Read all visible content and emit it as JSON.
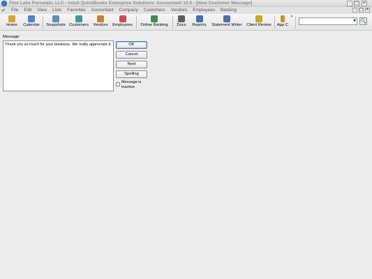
{
  "window": {
    "title": "Pine Lake Porcelain, LLC  -  Intuit QuickBooks Enterprise Solutions: Accountant 12.0 - [New Customer Message]",
    "controls": [
      "–",
      "□",
      "✕"
    ]
  },
  "menu": {
    "items": [
      "File",
      "Edit",
      "View",
      "Lists",
      "Favorites",
      "Accountant",
      "Company",
      "Customers",
      "Vendors",
      "Employees",
      "Banking"
    ],
    "sys_controls": [
      "–",
      "□",
      "✕"
    ]
  },
  "toolbar": {
    "buttons": [
      {
        "label": "Home",
        "icon": "home-icon",
        "color": "#d9a13b"
      },
      {
        "label": "Calendar",
        "icon": "calendar-icon",
        "color": "#4a86c7"
      },
      {
        "label": "Snapshots",
        "icon": "snapshots-icon",
        "color": "#5e8fbf"
      },
      {
        "label": "Customers",
        "icon": "customers-icon",
        "color": "#3f9a8f"
      },
      {
        "label": "Vendors",
        "icon": "vendors-icon",
        "color": "#c9822f"
      },
      {
        "label": "Employees",
        "icon": "employees-icon",
        "color": "#c94f4f"
      },
      {
        "label": "Online Banking",
        "icon": "online-banking-icon",
        "color": "#3f8f4f"
      },
      {
        "label": "Docs",
        "icon": "docs-icon",
        "color": "#5f5f5f"
      },
      {
        "label": "Reports",
        "icon": "reports-icon",
        "color": "#3d73b4"
      },
      {
        "label": "Statement Writer",
        "icon": "statement-writer-icon",
        "color": "#4d6fa5"
      },
      {
        "label": "Client Review",
        "icon": "client-review-icon",
        "color": "#c6a72d"
      },
      {
        "label": "App C",
        "icon": "app-center-icon",
        "color": "#d48a2a"
      }
    ],
    "overflow": "»",
    "search_value": "",
    "search_button": "🔍"
  },
  "form": {
    "message_label": "Message",
    "message_value": "Thank you so much for your business. We really appreciate it.",
    "buttons": {
      "ok": "OK",
      "cancel": "Cancel",
      "next": "Next",
      "spelling": "Spelling"
    },
    "inactive_label": "Message is inactive",
    "inactive_checked": false
  }
}
